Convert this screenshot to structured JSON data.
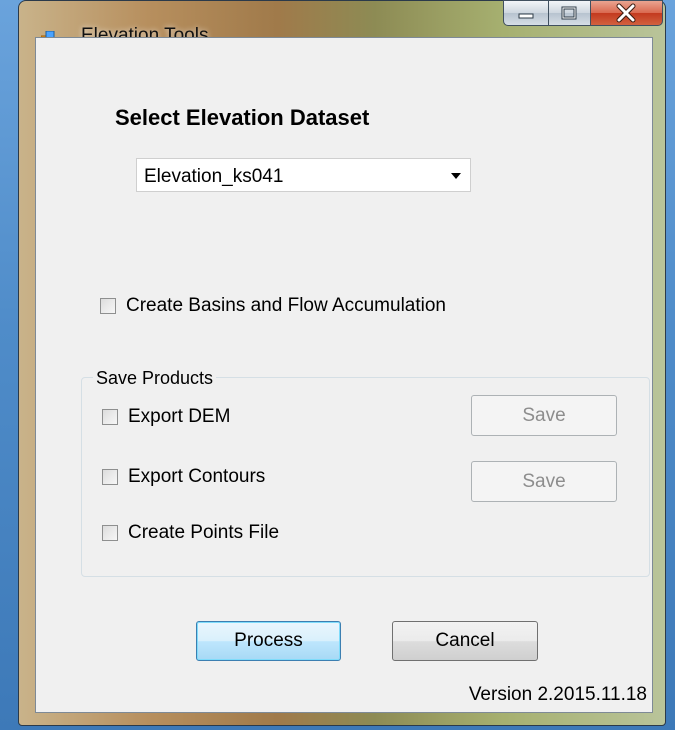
{
  "window": {
    "title": "Elevation Tools",
    "icons": [
      "app-icon",
      "minimize-icon",
      "maximize-icon",
      "close-icon"
    ]
  },
  "dataset": {
    "heading": "Select Elevation Dataset",
    "selected": "Elevation_ks041"
  },
  "options": {
    "create_basins_label": "Create Basins and Flow Accumulation"
  },
  "save_products": {
    "legend": "Save Products",
    "export_dem_label": "Export DEM",
    "export_dem_save": "Save",
    "export_contours_label": "Export Contours",
    "export_contours_save": "Save",
    "create_points_label": "Create Points File"
  },
  "actions": {
    "process_label": "Process",
    "cancel_label": "Cancel"
  },
  "footer": {
    "version": "Version 2.2015.11.18"
  },
  "colors": {
    "accent": "#3c7fb1",
    "close_button": "#c33a1f"
  }
}
